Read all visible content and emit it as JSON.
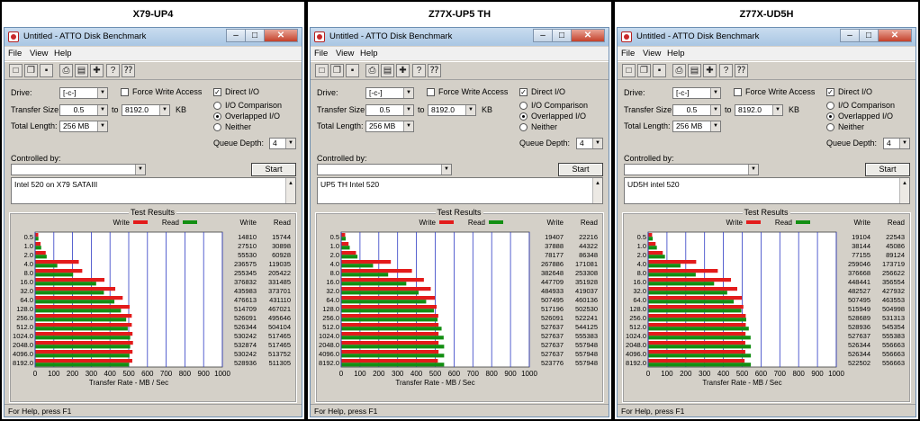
{
  "panels": [
    {
      "caption": "X79-UP4",
      "window_title": "Untitled - ATTO Disk Benchmark",
      "menu": [
        "File",
        "View",
        "Help"
      ],
      "drive_label": "Drive:",
      "drive_value": "[-c-]",
      "force_write_access_label": "Force Write Access",
      "direct_io_label": "Direct I/O",
      "transfer_size_label": "Transfer Size:",
      "transfer_size_from": "0.5",
      "to_label": "to",
      "transfer_size_to": "8192.0",
      "kb_label": "KB",
      "total_length_label": "Total Length:",
      "total_length_value": "256 MB",
      "io_comparison_label": "I/O Comparison",
      "overlapped_io_label": "Overlapped I/O",
      "neither_label": "Neither",
      "queue_depth_label": "Queue Depth:",
      "queue_depth_value": "4",
      "controlled_by_label": "Controlled by:",
      "start_label": "Start",
      "description": "Intel 520 on X79 SATAIII",
      "test_results_label": "Test Results",
      "legend_write": "Write",
      "legend_read": "Read",
      "col_write": "Write",
      "col_read": "Read",
      "xlabel": "Transfer Rate - MB / Sec",
      "status": "For Help, press F1"
    },
    {
      "caption": "Z77X-UP5 TH",
      "window_title": "Untitled - ATTO Disk Benchmark",
      "menu": [
        "File",
        "View",
        "Help"
      ],
      "drive_label": "Drive:",
      "drive_value": "[-c-]",
      "force_write_access_label": "Force Write Access",
      "direct_io_label": "Direct I/O",
      "transfer_size_label": "Transfer Size:",
      "transfer_size_from": "0.5",
      "to_label": "to",
      "transfer_size_to": "8192.0",
      "kb_label": "KB",
      "total_length_label": "Total Length:",
      "total_length_value": "256 MB",
      "io_comparison_label": "I/O Comparison",
      "overlapped_io_label": "Overlapped I/O",
      "neither_label": "Neither",
      "queue_depth_label": "Queue Depth:",
      "queue_depth_value": "4",
      "controlled_by_label": "Controlled by:",
      "start_label": "Start",
      "description": "UP5 TH Intel 520",
      "test_results_label": "Test Results",
      "legend_write": "Write",
      "legend_read": "Read",
      "col_write": "Write",
      "col_read": "Read",
      "xlabel": "Transfer Rate - MB / Sec",
      "status": "For Help, press F1"
    },
    {
      "caption": "Z77X-UD5H",
      "window_title": "Untitled - ATTO Disk Benchmark",
      "menu": [
        "File",
        "View",
        "Help"
      ],
      "drive_label": "Drive:",
      "drive_value": "[-c-]",
      "force_write_access_label": "Force Write Access",
      "direct_io_label": "Direct I/O",
      "transfer_size_label": "Transfer Size:",
      "transfer_size_from": "0.5",
      "to_label": "to",
      "transfer_size_to": "8192.0",
      "kb_label": "KB",
      "total_length_label": "Total Length:",
      "total_length_value": "256 MB",
      "io_comparison_label": "I/O Comparison",
      "overlapped_io_label": "Overlapped I/O",
      "neither_label": "Neither",
      "queue_depth_label": "Queue Depth:",
      "queue_depth_value": "4",
      "controlled_by_label": "Controlled by:",
      "start_label": "Start",
      "description": "UD5H intel 520",
      "test_results_label": "Test Results",
      "legend_write": "Write",
      "legend_read": "Read",
      "col_write": "Write",
      "col_read": "Read",
      "xlabel": "Transfer Rate - MB / Sec",
      "status": "For Help, press F1"
    }
  ],
  "colors": {
    "write": "#e31b1b",
    "read": "#138f13",
    "grid": "#2f3cc4"
  },
  "toolbar_icons": [
    "new-file-icon",
    "open-folder-icon",
    "save-icon",
    "print-icon",
    "print-preview-icon",
    "move-icon",
    "help-icon",
    "context-help-icon"
  ],
  "chart_data": [
    {
      "type": "bar",
      "orientation": "horizontal",
      "categories": [
        "0.5",
        "1.0",
        "2.0",
        "4.0",
        "8.0",
        "16.0",
        "32.0",
        "64.0",
        "128.0",
        "256.0",
        "512.0",
        "1024.0",
        "2048.0",
        "4096.0",
        "8192.0"
      ],
      "series": [
        {
          "name": "Write",
          "values": [
            14810,
            27510,
            55530,
            236575,
            255345,
            376832,
            435983,
            476613,
            514709,
            526091,
            526344,
            530242,
            532874,
            530242,
            528936
          ]
        },
        {
          "name": "Read",
          "values": [
            15744,
            30898,
            60928,
            119035,
            205422,
            331485,
            373701,
            431110,
            467021,
            495646,
            504104,
            517465,
            517465,
            513752,
            511305
          ]
        }
      ],
      "xlim": [
        0,
        1000
      ],
      "xticks": [
        0,
        100,
        200,
        300,
        400,
        500,
        600,
        700,
        800,
        900,
        1000
      ],
      "xlabel": "Transfer Rate - MB / Sec",
      "grid": true
    },
    {
      "type": "bar",
      "orientation": "horizontal",
      "categories": [
        "0.5",
        "1.0",
        "2.0",
        "4.0",
        "8.0",
        "16.0",
        "32.0",
        "64.0",
        "128.0",
        "256.0",
        "512.0",
        "1024.0",
        "2048.0",
        "4096.0",
        "8192.0"
      ],
      "series": [
        {
          "name": "Write",
          "values": [
            19407,
            37888,
            78177,
            267886,
            382648,
            447709,
            484933,
            507495,
            517196,
            526091,
            527637,
            527637,
            527637,
            527637,
            523776
          ]
        },
        {
          "name": "Read",
          "values": [
            22216,
            44322,
            86348,
            171081,
            253308,
            351928,
            419037,
            460136,
            502530,
            522241,
            544125,
            555383,
            557948,
            557948,
            557948
          ]
        }
      ],
      "xlim": [
        0,
        1000
      ],
      "xticks": [
        0,
        100,
        200,
        300,
        400,
        500,
        600,
        700,
        800,
        900,
        1000
      ],
      "xlabel": "Transfer Rate - MB / Sec",
      "grid": true
    },
    {
      "type": "bar",
      "orientation": "horizontal",
      "categories": [
        "0.5",
        "1.0",
        "2.0",
        "4.0",
        "8.0",
        "16.0",
        "32.0",
        "64.0",
        "128.0",
        "256.0",
        "512.0",
        "1024.0",
        "2048.0",
        "4096.0",
        "8192.0"
      ],
      "series": [
        {
          "name": "Write",
          "values": [
            19104,
            38144,
            77155,
            259046,
            376668,
            448441,
            482527,
            507495,
            515949,
            528689,
            528936,
            527637,
            526344,
            526344,
            522502
          ]
        },
        {
          "name": "Read",
          "values": [
            22543,
            45086,
            89124,
            173719,
            256622,
            356554,
            427932,
            463553,
            504998,
            531313,
            545354,
            555383,
            556663,
            556663,
            556663
          ]
        }
      ],
      "xlim": [
        0,
        1000
      ],
      "xticks": [
        0,
        100,
        200,
        300,
        400,
        500,
        600,
        700,
        800,
        900,
        1000
      ],
      "xlabel": "Transfer Rate - MB / Sec",
      "grid": true
    }
  ]
}
